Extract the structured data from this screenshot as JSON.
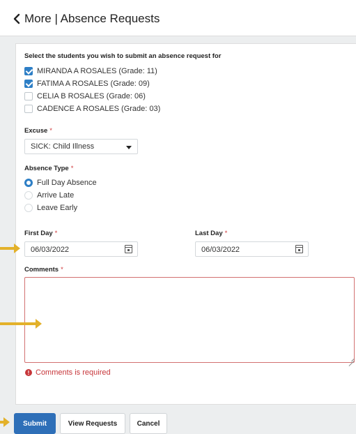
{
  "header": {
    "title": "More | Absence Requests",
    "back_icon": "chevron-left-icon"
  },
  "form": {
    "instruction": "Select the students you wish to submit an absence request for",
    "students": [
      {
        "label": "MIRANDA A ROSALES (Grade: 11)",
        "checked": true
      },
      {
        "label": "FATIMA A ROSALES (Grade: 09)",
        "checked": true
      },
      {
        "label": "CELIA B ROSALES (Grade: 06)",
        "checked": false
      },
      {
        "label": "CADENCE A ROSALES (Grade: 03)",
        "checked": false
      }
    ],
    "excuse": {
      "label": "Excuse",
      "value": "SICK: Child Illness"
    },
    "absence_type": {
      "label": "Absence Type",
      "options": [
        {
          "label": "Full Day Absence",
          "selected": true
        },
        {
          "label": "Arrive Late",
          "selected": false
        },
        {
          "label": "Leave Early",
          "selected": false
        }
      ]
    },
    "first_day": {
      "label": "First Day",
      "value": "06/03/2022"
    },
    "last_day": {
      "label": "Last Day",
      "value": "06/03/2022"
    },
    "comments": {
      "label": "Comments",
      "value": ""
    },
    "required_mark": "*",
    "error": {
      "text": "Comments is required",
      "icon": "!"
    }
  },
  "buttons": {
    "submit": "Submit",
    "view_requests": "View Requests",
    "cancel": "Cancel"
  },
  "colors": {
    "accent": "#2e7fc6",
    "submit_bg": "#2e6fb8",
    "error": "#c7363a",
    "arrow": "#e3b12a"
  }
}
